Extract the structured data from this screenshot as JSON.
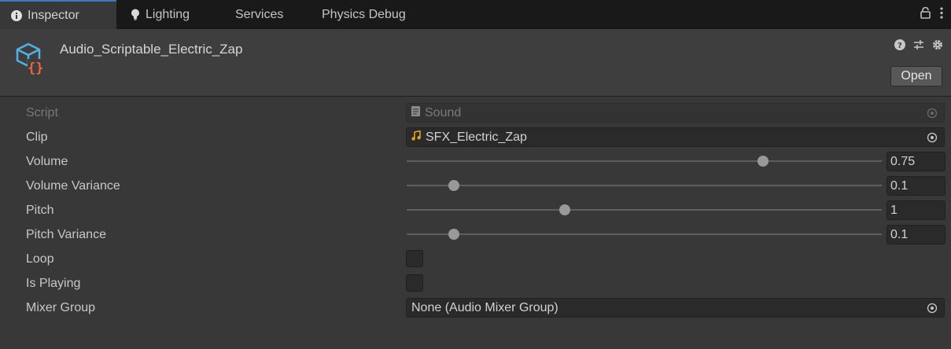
{
  "tabs": [
    {
      "label": "Inspector",
      "icon": "info-icon",
      "active": true
    },
    {
      "label": "Lighting",
      "icon": "lightbulb-icon",
      "active": false
    },
    {
      "label": "Services",
      "active": false
    },
    {
      "label": "Physics Debug",
      "active": false
    }
  ],
  "header": {
    "title": "Audio_Scriptable_Electric_Zap",
    "icon": "scriptable-object-icon",
    "open_label": "Open"
  },
  "properties": {
    "script": {
      "label": "Script",
      "value": "Sound"
    },
    "clip": {
      "label": "Clip",
      "value": "SFX_Electric_Zap"
    },
    "volume": {
      "label": "Volume",
      "value": "0.75",
      "level": 0.75,
      "min": 0,
      "max": 1
    },
    "volume_variance": {
      "label": "Volume Variance",
      "value": "0.1",
      "level": 0.1,
      "min": 0,
      "max": 1
    },
    "pitch": {
      "label": "Pitch",
      "value": "1",
      "level": 1,
      "min": 0,
      "max": 3
    },
    "pitch_variance": {
      "label": "Pitch Variance",
      "value": "0.1",
      "level": 0.1,
      "min": 0,
      "max": 1
    },
    "loop": {
      "label": "Loop",
      "checked": false
    },
    "is_playing": {
      "label": "Is Playing",
      "checked": false
    },
    "mixer_group": {
      "label": "Mixer Group",
      "value": "None (Audio Mixer Group)"
    }
  },
  "colors": {
    "accent": "#3a79bb",
    "asset_icon_cube": "#4fb3e8",
    "asset_icon_braces": "#f0643c",
    "audio_clip_icon": "#e6a21a"
  }
}
